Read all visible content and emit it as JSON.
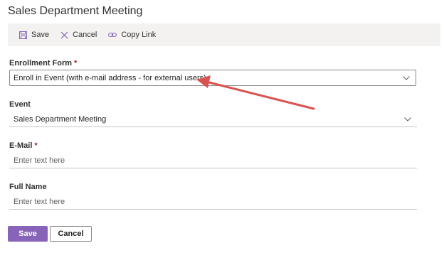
{
  "page": {
    "title": "Sales Department Meeting"
  },
  "toolbar": {
    "save_label": "Save",
    "cancel_label": "Cancel",
    "copy_link_label": "Copy Link"
  },
  "form": {
    "enrollment_form": {
      "label": "Enrollment Form",
      "required": "*",
      "value": "Enroll in Event (with e-mail address - for external users)"
    },
    "event": {
      "label": "Event",
      "value": "Sales Department Meeting"
    },
    "email": {
      "label": "E-Mail",
      "required": "*",
      "placeholder": "Enter text here"
    },
    "full_name": {
      "label": "Full Name",
      "placeholder": "Enter text here"
    }
  },
  "actions": {
    "save_label": "Save",
    "cancel_label": "Cancel"
  },
  "colors": {
    "primary": "#8764b8",
    "toolbar_bg": "#f3f2f1",
    "required": "#a4262c",
    "annotation_arrow": "#d9534f"
  },
  "icons": [
    "save-icon",
    "cancel-icon",
    "link-icon",
    "chevron-down-icon"
  ]
}
